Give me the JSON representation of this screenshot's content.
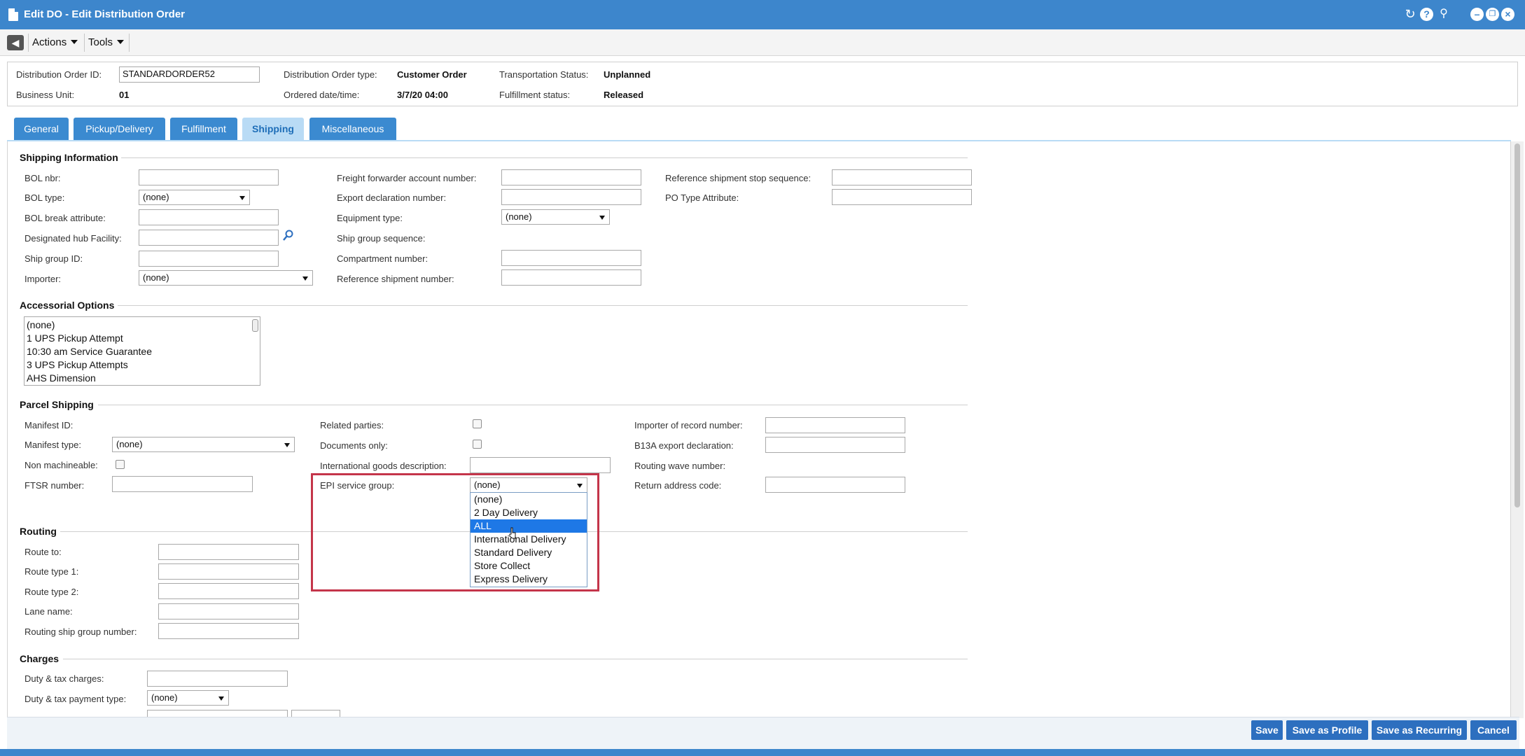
{
  "window": {
    "title": "Edit DO - Edit Distribution Order",
    "icons": [
      "refresh-icon",
      "help-icon",
      "pin-icon",
      "minimize-icon",
      "restore-icon",
      "close-icon"
    ]
  },
  "toolbar": {
    "actions_label": "Actions",
    "tools_label": "Tools"
  },
  "header": {
    "do_id_label": "Distribution Order ID:",
    "do_id_value": "STANDARDORDER52",
    "business_unit_label": "Business Unit:",
    "business_unit_value": "01",
    "do_type_label": "Distribution Order type:",
    "do_type_value": "Customer Order",
    "ordered_label": "Ordered date/time:",
    "ordered_value": "3/7/20 04:00",
    "transport_label": "Transportation Status:",
    "transport_value": "Unplanned",
    "fulfillment_label": "Fulfillment status:",
    "fulfillment_value": "Released"
  },
  "tabs": [
    {
      "label": "General"
    },
    {
      "label": "Pickup/Delivery"
    },
    {
      "label": "Fulfillment"
    },
    {
      "label": "Shipping"
    },
    {
      "label": "Miscellaneous"
    }
  ],
  "shipping_info": {
    "title": "Shipping Information",
    "bol_nbr": "BOL nbr:",
    "bol_type": "BOL type:",
    "bol_type_value": "(none)",
    "bol_break": "BOL break attribute:",
    "hub": "Designated hub Facility:",
    "ship_group_id": "Ship group ID:",
    "importer": "Importer:",
    "importer_value": "(none)",
    "freight_forwarder": "Freight forwarder account number:",
    "export_decl": "Export declaration number:",
    "equipment_type": "Equipment type:",
    "equipment_type_value": "(none)",
    "ship_group_seq": "Ship group sequence:",
    "compartment": "Compartment number:",
    "ref_shipment": "Reference shipment number:",
    "ref_stop_seq": "Reference shipment stop sequence:",
    "po_type": "PO Type Attribute:"
  },
  "accessorial": {
    "title": "Accessorial Options",
    "options": [
      "(none)",
      "1 UPS Pickup Attempt",
      "10:30 am Service Guarantee",
      "3 UPS Pickup Attempts",
      "AHS Dimension"
    ]
  },
  "parcel": {
    "title": "Parcel Shipping",
    "manifest_id": "Manifest ID:",
    "manifest_type": "Manifest type:",
    "manifest_type_value": "(none)",
    "non_machineable": "Non machineable:",
    "ftsr": "FTSR number:",
    "related_parties": "Related parties:",
    "documents_only": "Documents only:",
    "intl_goods": "International goods description:",
    "epi_group": "EPI service group:",
    "epi_group_value": "(none)",
    "importer_record": "Importer of record number:",
    "b13a": "B13A export declaration:",
    "routing_wave": "Routing wave number:",
    "return_address": "Return address code:"
  },
  "epi_dropdown": {
    "options": [
      "(none)",
      "2 Day Delivery",
      "ALL",
      "International Delivery",
      "Standard Delivery",
      "Store Collect",
      "Express Delivery"
    ],
    "highlighted": "ALL"
  },
  "routing": {
    "title": "Routing",
    "route_to": "Route to:",
    "route_type1": "Route type 1:",
    "route_type2": "Route type 2:",
    "lane_name": "Lane name:",
    "routing_ship_group": "Routing ship group number:"
  },
  "charges": {
    "title": "Charges",
    "duty_tax": "Duty & tax charges:",
    "duty_tax_payment": "Duty & tax payment type:",
    "duty_tax_payment_value": "(none)"
  },
  "buttons": {
    "save": "Save",
    "save_profile": "Save as Profile",
    "save_recurring": "Save as Recurring",
    "cancel": "Cancel"
  },
  "colors": {
    "title_bar": "#3d86cc",
    "tab": "#3b8ad0",
    "tab_active": "#b9dbf5",
    "highlight_box": "#c4354a",
    "dropdown_selected": "#1e78e6",
    "button": "#2d6fbf"
  }
}
